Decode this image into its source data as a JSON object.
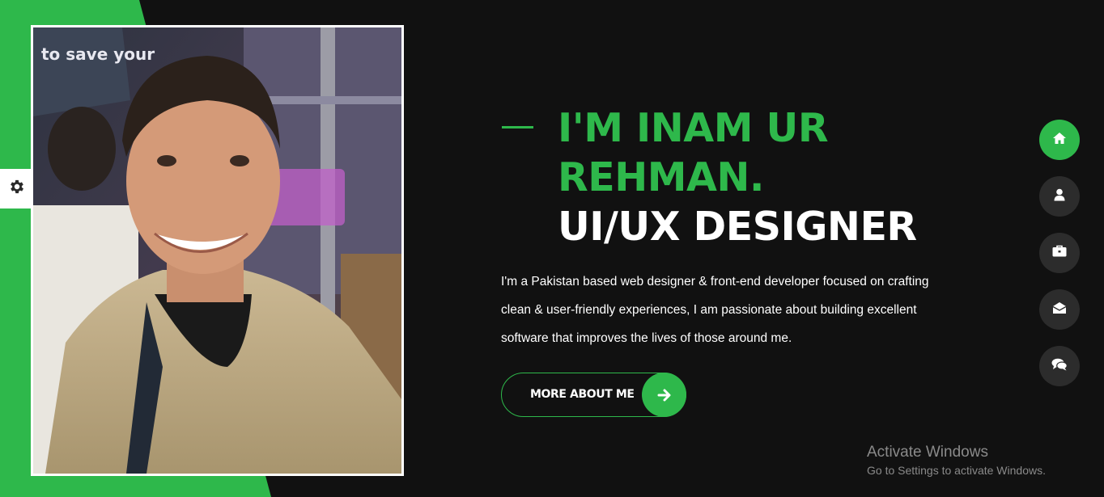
{
  "theme": {
    "accent": "#2eb84b",
    "background": "#111111",
    "nav_button": "#2c2c2c",
    "text": "#ffffff"
  },
  "hero": {
    "greeting_name": "I'M INAM UR REHMAN.",
    "role": "UI/UX DESIGNER",
    "description": "I'm a Pakistan based web designer & front-end developer focused on crafting clean & user-friendly experiences, I am passionate about building excellent software that improves the lives of those around me.",
    "cta_label": "MORE ABOUT ME",
    "cta_icon": "arrow-right-icon"
  },
  "photo": {
    "sign_text": "to save your"
  },
  "settings_icon": "gear-icon",
  "side_nav": [
    {
      "icon": "home-icon",
      "active": true
    },
    {
      "icon": "user-icon",
      "active": false
    },
    {
      "icon": "briefcase-icon",
      "active": false
    },
    {
      "icon": "envelope-open-icon",
      "active": false
    },
    {
      "icon": "comments-icon",
      "active": false
    }
  ],
  "watermark": {
    "title": "Activate Windows",
    "subtitle": "Go to Settings to activate Windows."
  }
}
